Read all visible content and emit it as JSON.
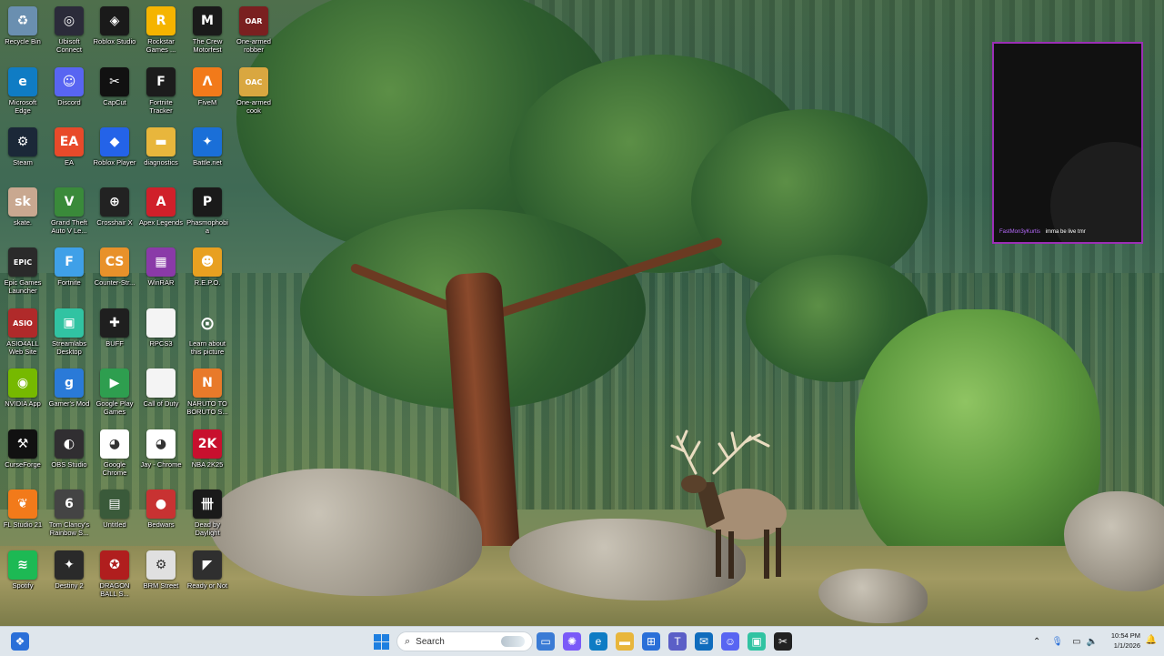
{
  "desktop": {
    "icons": [
      {
        "label": "Recycle Bin",
        "icon": "recycle-bin-icon",
        "color": "#6a8fb0",
        "symbol": "♻"
      },
      {
        "label": "Ubisoft Connect",
        "icon": "ubisoft-icon",
        "color": "#2b2b3a",
        "symbol": "◎"
      },
      {
        "label": "Roblox Studio",
        "icon": "roblox-studio-icon",
        "color": "#1a1a1a",
        "symbol": "◈"
      },
      {
        "label": "Rockstar Games ...",
        "icon": "rockstar-icon",
        "color": "#f5b400",
        "symbol": "R"
      },
      {
        "label": "The Crew Motorfest",
        "icon": "the-crew-icon",
        "color": "#1a1a1a",
        "symbol": "M"
      },
      {
        "label": "One-armed robber",
        "icon": "one-armed-robber-icon",
        "color": "#7a2020",
        "symbol": "OAR"
      },
      {
        "label": "Microsoft Edge",
        "icon": "edge-icon",
        "color": "#0f7cc4",
        "symbol": "e"
      },
      {
        "label": "Discord",
        "icon": "discord-icon",
        "color": "#5865f2",
        "symbol": "☺"
      },
      {
        "label": "CapCut",
        "icon": "capcut-icon",
        "color": "#111111",
        "symbol": "✂"
      },
      {
        "label": "Fortnite Tracker",
        "icon": "fortnite-tracker-icon",
        "color": "#1c1c1c",
        "symbol": "F"
      },
      {
        "label": "FiveM",
        "icon": "fivem-icon",
        "color": "#f27a1a",
        "symbol": "Λ"
      },
      {
        "label": "One-armed cook",
        "icon": "one-armed-cook-icon",
        "color": "#d9a740",
        "symbol": "OAC"
      },
      {
        "label": "Steam",
        "icon": "steam-icon",
        "color": "#1b2838",
        "symbol": "⚙"
      },
      {
        "label": "EA",
        "icon": "ea-icon",
        "color": "#e84a2a",
        "symbol": "EA"
      },
      {
        "label": "Roblox Player",
        "icon": "roblox-player-icon",
        "color": "#2463e8",
        "symbol": "◆"
      },
      {
        "label": "diagnostics",
        "icon": "folder-icon",
        "color": "#e8b63c",
        "symbol": "▬"
      },
      {
        "label": "Battle.net",
        "icon": "battlenet-icon",
        "color": "#1a6fd8",
        "symbol": "✦"
      },
      {
        "label": "skate.",
        "icon": "skate-icon",
        "color": "#c9a890",
        "symbol": "sk"
      },
      {
        "label": "Grand Theft Auto V Le...",
        "icon": "gta-icon",
        "color": "#3a8a3a",
        "symbol": "V"
      },
      {
        "label": "Crosshair X",
        "icon": "crosshair-icon",
        "color": "#222222",
        "symbol": "⊕"
      },
      {
        "label": "Apex Legends",
        "icon": "apex-icon",
        "color": "#d0202a",
        "symbol": "A"
      },
      {
        "label": "Phasmophobia",
        "icon": "phasmophobia-icon",
        "color": "#1a1a1a",
        "symbol": "P"
      },
      {
        "label": "Epic Games Launcher",
        "icon": "epic-games-icon",
        "color": "#2a2a2a",
        "symbol": "EPIC"
      },
      {
        "label": "Fortnite",
        "icon": "fortnite-icon",
        "color": "#3fa0e8",
        "symbol": "F"
      },
      {
        "label": "Counter-Str...",
        "icon": "counter-strike-icon",
        "color": "#e8912a",
        "symbol": "CS"
      },
      {
        "label": "WinRAR",
        "icon": "winrar-icon",
        "color": "#8a3aa8",
        "symbol": "▦"
      },
      {
        "label": "R.E.P.O.",
        "icon": "repo-icon",
        "color": "#e8a020",
        "symbol": "☻"
      },
      {
        "label": "ASIO4ALL Web Site",
        "icon": "asio-icon",
        "color": "#b02a2a",
        "symbol": "ASIO"
      },
      {
        "label": "Streamlabs Desktop",
        "icon": "streamlabs-icon",
        "color": "#31c3a2",
        "symbol": "▣"
      },
      {
        "label": "BUFF",
        "icon": "buff-icon",
        "color": "#1f1f1f",
        "symbol": "✚"
      },
      {
        "label": "RPCS3",
        "icon": "file-icon",
        "color": "#f4f4f4",
        "symbol": ""
      },
      {
        "label": "Learn about this picture",
        "icon": "learn-picture-icon",
        "color": "transparent",
        "symbol": "⊙"
      },
      {
        "label": "NVIDIA App",
        "icon": "nvidia-icon",
        "color": "#76b900",
        "symbol": "◉"
      },
      {
        "label": "Gamer's Mod",
        "icon": "gamers-mod-icon",
        "color": "#2a7ad8",
        "symbol": "g"
      },
      {
        "label": "Google Play Games",
        "icon": "google-play-games-icon",
        "color": "#2e9e4f",
        "symbol": "▶"
      },
      {
        "label": "Call of Duty",
        "icon": "file-icon",
        "color": "#f4f4f4",
        "symbol": ""
      },
      {
        "label": "NARUTO TO BORUTO S...",
        "icon": "naruto-icon",
        "color": "#e87a2a",
        "symbol": "N"
      },
      {
        "label": "CurseForge",
        "icon": "curseforge-icon",
        "color": "#111111",
        "symbol": "⚒"
      },
      {
        "label": "OBS Studio",
        "icon": "obs-icon",
        "color": "#302e31",
        "symbol": "◐"
      },
      {
        "label": "Google Chrome",
        "icon": "chrome-icon",
        "color": "#ffffff",
        "symbol": "◕"
      },
      {
        "label": "Jay - Chrome",
        "icon": "chrome-profile-icon",
        "color": "#ffffff",
        "symbol": "◕"
      },
      {
        "label": "NBA 2K25",
        "icon": "nba2k-icon",
        "color": "#c8102e",
        "symbol": "2K"
      },
      {
        "label": "FL Studio 21",
        "icon": "fl-studio-icon",
        "color": "#f27a1a",
        "symbol": "❦"
      },
      {
        "label": "Tom Clancy's Rainbow S...",
        "icon": "rainbow-six-icon",
        "color": "#444444",
        "symbol": "6"
      },
      {
        "label": "Untitled",
        "icon": "untitled-icon",
        "color": "#3a5a3a",
        "symbol": "▤"
      },
      {
        "label": "Bedwars",
        "icon": "bedwars-icon",
        "color": "#c83232",
        "symbol": "●"
      },
      {
        "label": "Dead by Daylight",
        "icon": "dbd-icon",
        "color": "#1a1a1a",
        "symbol": "卌"
      },
      {
        "label": "Spotify",
        "icon": "spotify-icon",
        "color": "#1db954",
        "symbol": "≋"
      },
      {
        "label": "Destiny 2",
        "icon": "destiny-icon",
        "color": "#2a2a2a",
        "symbol": "✦"
      },
      {
        "label": "DRAGON BALL S...",
        "icon": "dragonball-icon",
        "color": "#b01e1e",
        "symbol": "✪"
      },
      {
        "label": "BRM Street",
        "icon": "brm-icon",
        "color": "#e0e0e0",
        "symbol": "⚙"
      },
      {
        "label": "Ready or Not",
        "icon": "ready-or-not-icon",
        "color": "#2f2f2f",
        "symbol": "◤"
      }
    ]
  },
  "chat_widget": {
    "user": "FastMon3yKurtis",
    "message": "imma be live tmr"
  },
  "taskbar": {
    "search_placeholder": "Search",
    "pinned": [
      {
        "name": "start-button",
        "icon": "windows-start-icon"
      },
      {
        "name": "taskbar-file-explorer-window",
        "icon": "window-icon",
        "symbol": "▭",
        "color": "#3a7bd5"
      },
      {
        "name": "taskbar-copilot",
        "icon": "copilot-icon",
        "symbol": "✺",
        "color": "#7a5af8"
      },
      {
        "name": "taskbar-edge",
        "icon": "edge-icon",
        "symbol": "e",
        "color": "#0f7cc4"
      },
      {
        "name": "taskbar-file-explorer",
        "icon": "folder-icon",
        "symbol": "▬",
        "color": "#e8b63c"
      },
      {
        "name": "taskbar-store",
        "icon": "store-icon",
        "symbol": "⊞",
        "color": "#2a6fd8"
      },
      {
        "name": "taskbar-teams",
        "icon": "teams-icon",
        "symbol": "T",
        "color": "#5b5fc7"
      },
      {
        "name": "taskbar-outlook",
        "icon": "outlook-icon",
        "symbol": "✉",
        "color": "#0f6cbd"
      },
      {
        "name": "taskbar-discord",
        "icon": "discord-icon",
        "symbol": "☺",
        "color": "#5865f2"
      },
      {
        "name": "taskbar-streamlabs",
        "icon": "streamlabs-icon",
        "symbol": "▣",
        "color": "#31c3a2"
      },
      {
        "name": "taskbar-capcut",
        "icon": "capcut-icon",
        "symbol": "✂",
        "color": "#222222"
      }
    ],
    "clock_time": "10:54 PM",
    "clock_date": "1/1/2026"
  }
}
